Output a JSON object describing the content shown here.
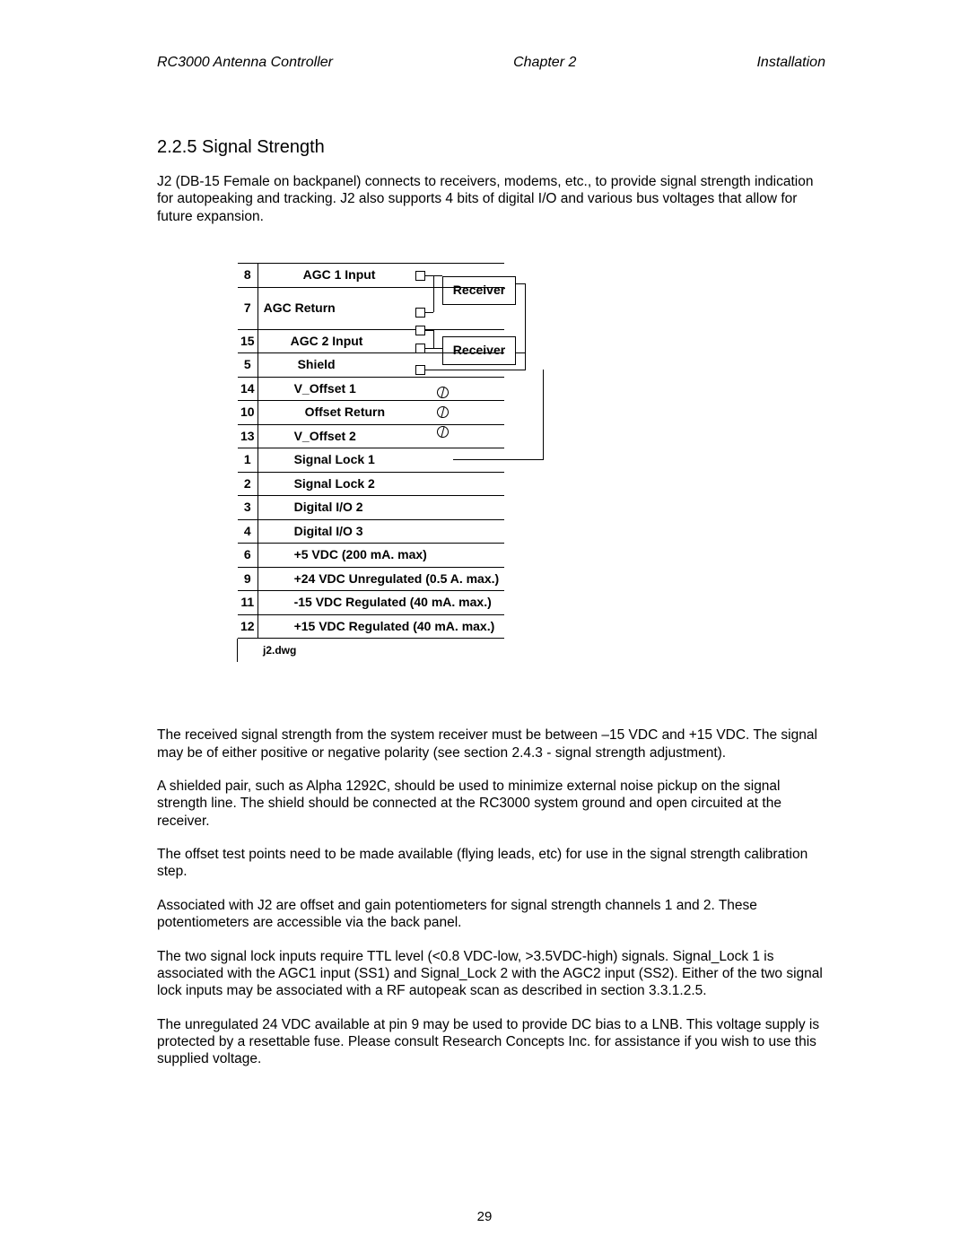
{
  "header": {
    "left": "RC3000 Antenna Controller",
    "center": "Chapter 2",
    "right": "Installation"
  },
  "section_title": "2.2.5 Signal Strength",
  "intro": "J2 (DB-15 Female on backpanel) connects to receivers, modems, etc., to provide signal strength indication for autopeaking and tracking. J2 also supports 4 bits of digital I/O and various bus voltages that allow for future expansion.",
  "diagram": {
    "receiver1": "Receiver",
    "receiver2": "Receiver",
    "file": "j2.dwg",
    "rows": [
      {
        "pin": "8",
        "label": "AGC 1 Input"
      },
      {
        "pin": "7",
        "label": "AGC Return"
      },
      {
        "pin": "15",
        "label": "AGC 2 Input"
      },
      {
        "pin": "5",
        "label": "Shield"
      },
      {
        "pin": "14",
        "label": "V_Offset 1"
      },
      {
        "pin": "10",
        "label": "Offset Return"
      },
      {
        "pin": "13",
        "label": "V_Offset 2"
      },
      {
        "pin": "1",
        "label": "Signal Lock 1"
      },
      {
        "pin": "2",
        "label": "Signal Lock 2"
      },
      {
        "pin": "3",
        "label": "Digital I/O 2"
      },
      {
        "pin": "4",
        "label": "Digital I/O 3"
      },
      {
        "pin": "6",
        "label": "+5 VDC (200 mA. max)"
      },
      {
        "pin": "9",
        "label": "+24 VDC Unregulated (0.5 A. max.)"
      },
      {
        "pin": "11",
        "label": "-15 VDC Regulated (40 mA. max.)"
      },
      {
        "pin": "12",
        "label": "+15 VDC Regulated (40 mA. max.)"
      }
    ]
  },
  "paragraphs": {
    "p1": "The received signal strength from the system receiver must be between –15 VDC and +15 VDC.  The signal may be of either positive or negative polarity (see section 2.4.3 - signal strength adjustment).",
    "p2": "A shielded pair, such as Alpha 1292C, should be used to minimize external noise pickup on the signal strength line.  The shield should be connected at the RC3000 system ground and open circuited at the receiver.",
    "p3": "The offset test points need to be made available (flying leads, etc) for use in the signal strength calibration step.",
    "p4": "Associated with J2 are offset and gain potentiometers for signal strength channels 1 and 2.  These potentiometers are accessible via the back panel.",
    "p5": "The two signal lock inputs require TTL level (<0.8 VDC-low, >3.5VDC-high) signals.  Signal_Lock 1 is associated with the AGC1 input (SS1) and Signal_Lock 2 with the AGC2 input (SS2).  Either of the two signal lock inputs may be associated with a RF autopeak scan as described in section 3.3.1.2.5.",
    "p6": "The unregulated 24 VDC available at pin 9 may be used to provide DC bias to a LNB.  This voltage supply is protected by a resettable fuse.  Please consult Research Concepts Inc. for assistance if you wish to use this supplied voltage."
  },
  "page_number": "29"
}
